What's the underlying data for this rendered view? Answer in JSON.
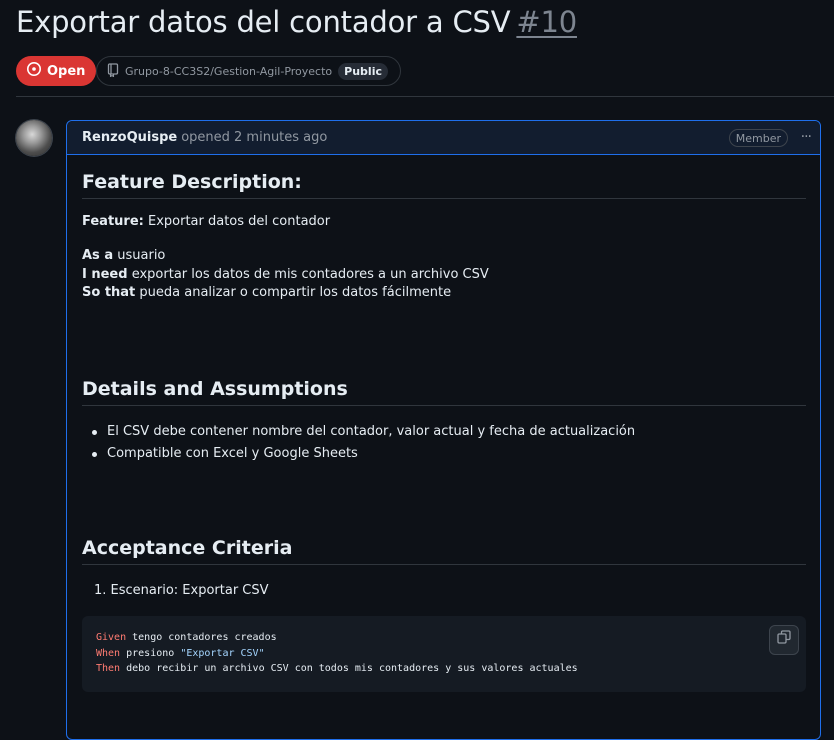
{
  "issue": {
    "title": "Exportar datos del contador a CSV",
    "number": "#10",
    "state": "Open",
    "repo": "Grupo-8-CC3S2/Gestion-Agil-Proyecto",
    "visibility": "Public"
  },
  "comment": {
    "author": "RenzoQuispe",
    "meta": "opened 2 minutes ago",
    "role": "Member",
    "menu_glyph": "···"
  },
  "body": {
    "feature_heading": "Feature Description:",
    "feature_label": "Feature:",
    "feature_text": "Exportar datos del contador",
    "as_a_label": "As a",
    "as_a_text": "usuario",
    "i_need_label": "I need",
    "i_need_text": "exportar los datos de mis contadores a un archivo CSV",
    "so_that_label": "So that",
    "so_that_text": "pueda analizar o compartir los datos fácilmente",
    "details_heading": "Details and Assumptions",
    "details_items": [
      "El CSV debe contener nombre del contador, valor actual y fecha de actualización",
      "Compatible con Excel y Google Sheets"
    ],
    "acceptance_heading": "Acceptance Criteria",
    "acceptance_item_marker": "1.",
    "acceptance_item": "Escenario: Exportar CSV",
    "code": {
      "line1_kw": "Given",
      "line1_text": " tengo contadores creados",
      "line2_kw": "When",
      "line2_text": " presiono ",
      "line2_str": "\"Exportar CSV\"",
      "line3_kw": "Then",
      "line3_text": " debo recibir un archivo CSV con todos mis contadores y sus valores actuales"
    }
  },
  "colors": {
    "open_state": "#da3633",
    "accent_border": "#1f6feb",
    "keyword": "#ff7b72",
    "string": "#a5d6ff"
  },
  "icons": {
    "state": "issue-opened-icon",
    "repo": "repo-icon",
    "copy": "copy-icon",
    "menu": "kebab-horizontal-icon"
  }
}
